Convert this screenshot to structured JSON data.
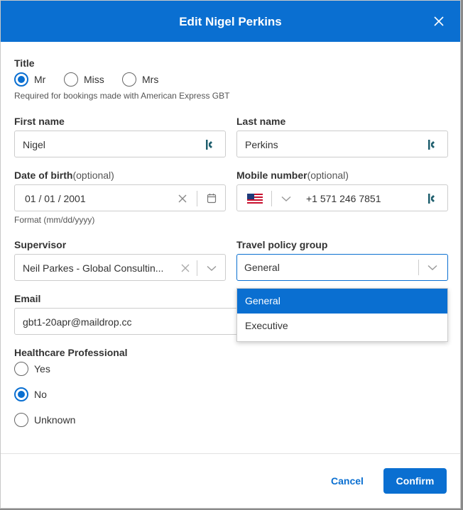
{
  "dialog": {
    "title": "Edit Nigel Perkins"
  },
  "title_field": {
    "label": "Title",
    "options": [
      {
        "label": "Mr",
        "checked": true
      },
      {
        "label": "Miss",
        "checked": false
      },
      {
        "label": "Mrs",
        "checked": false
      }
    ],
    "help": "Required for bookings made with American Express GBT"
  },
  "first_name": {
    "label": "First name",
    "value": "Nigel"
  },
  "last_name": {
    "label": "Last name",
    "value": "Perkins"
  },
  "dob": {
    "label": "Date of birth",
    "optional": "(optional)",
    "value": "01 / 01 / 2001",
    "help": "Format (mm/dd/yyyy)"
  },
  "mobile": {
    "label": "Mobile number",
    "optional": "(optional)",
    "value": "+1 571 246 7851"
  },
  "supervisor": {
    "label": "Supervisor",
    "value": "Neil Parkes - Global Consultin..."
  },
  "travel_policy": {
    "label": "Travel policy group",
    "value": "General",
    "options": [
      "General",
      "Executive"
    ],
    "selected_index": 0
  },
  "email": {
    "label": "Email",
    "value": "gbt1-20apr@maildrop.cc"
  },
  "healthcare": {
    "label": "Healthcare Professional",
    "options": [
      {
        "label": "Yes",
        "checked": false
      },
      {
        "label": "No",
        "checked": true
      },
      {
        "label": "Unknown",
        "checked": false
      }
    ]
  },
  "footer": {
    "cancel": "Cancel",
    "confirm": "Confirm"
  },
  "colors": {
    "primary": "#0a6fd1",
    "keeper_icon": "#1f5f6e"
  }
}
